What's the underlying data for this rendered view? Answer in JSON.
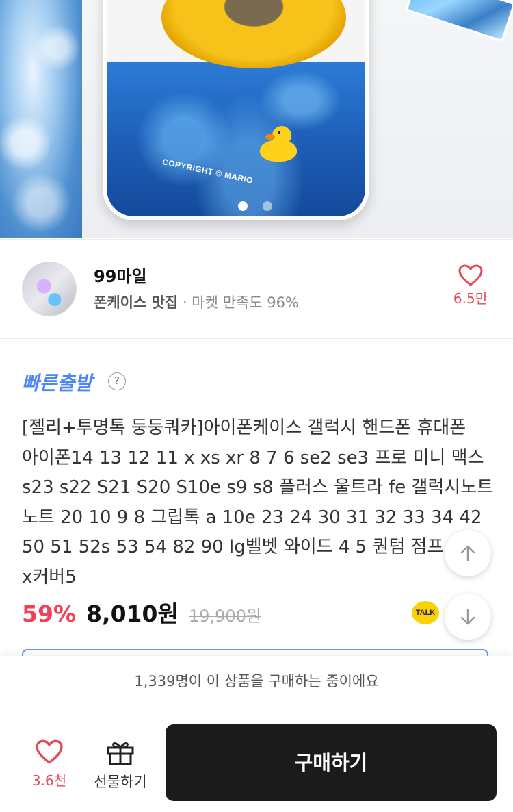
{
  "hero": {
    "image_text": "COPYRIGHT © MARIO",
    "slide_count": 2,
    "active_slide": 1
  },
  "seller": {
    "name": "99마일",
    "category": "폰케이스 맛집",
    "separator": "·",
    "satisfaction": "마켓 만족도 96%",
    "like_count": "6.5만"
  },
  "product": {
    "badge": "빠른출발",
    "help_icon": "?",
    "title": "[젤리+투명톡 둥둥쿼카]아이폰케이스 갤럭시 핸드폰 휴대폰 아이폰14 13 12 11 x xs xr 8 7 6 se2 se3 프로 미니 맥스 s23 s22 S21 S20 S10e s9 s8 플러스 울트라 fe 갤럭시노트 노트 20 10 9 8 그립톡 a 10e 23 24 30 31 32 33 34 42 50 51 52s 53 54 82 90 lg벨벳 와이드 4 5 퀀텀 점프 2 3 x커버5",
    "discount": "59%",
    "price": "8,010원",
    "original_price": "19,900원",
    "talk_label": "TALK"
  },
  "bottom_bar": {
    "buying_now": "1,339명이 이 상품을 구매하는 중이에요",
    "like_count": "3.6천",
    "gift_label": "선물하기",
    "buy_label": "구매하기"
  },
  "colors": {
    "accent_red": "#e24b59",
    "discount_red": "#f04156",
    "fast_blue": "#4e86f7",
    "buy_button": "#1b1b1b"
  },
  "icons": [
    "heart-icon",
    "question-icon",
    "kakao-talk-icon",
    "arrow-up-icon",
    "arrow-down-icon",
    "gift-icon"
  ]
}
